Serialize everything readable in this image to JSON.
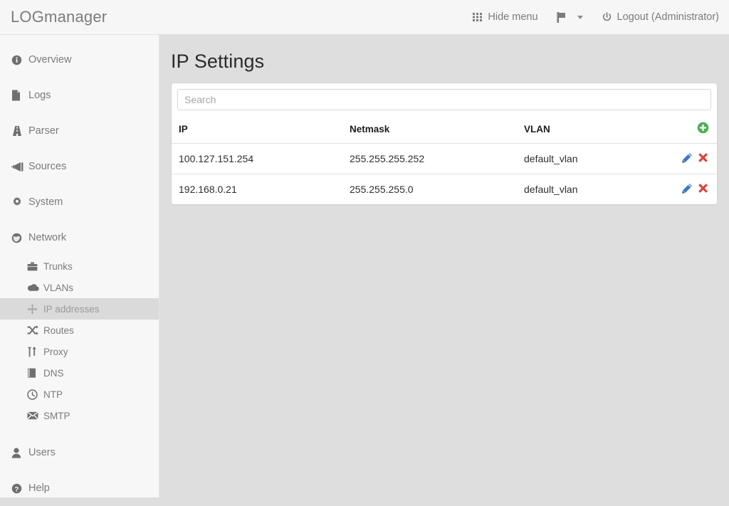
{
  "header": {
    "brand": "LOGmanager",
    "hide_menu_label": "Hide menu",
    "hide_menu_icon": "grid-icon",
    "language_icon": "flag-icon",
    "logout_label": "Logout (Administrator)",
    "logout_icon": "power-icon"
  },
  "sidebar": {
    "items": [
      {
        "label": "Overview",
        "icon": "info-circle-icon",
        "level": "main",
        "active": false
      },
      {
        "label": "Logs",
        "icon": "file-icon",
        "level": "main",
        "active": false
      },
      {
        "label": "Parser",
        "icon": "road-icon",
        "level": "main",
        "active": false
      },
      {
        "label": "Sources",
        "icon": "bullhorn-icon",
        "level": "main",
        "active": false
      },
      {
        "label": "System",
        "icon": "gear-icon",
        "level": "main",
        "active": false
      },
      {
        "label": "Network",
        "icon": "globe-icon",
        "level": "main",
        "active": false
      },
      {
        "label": "Trunks",
        "icon": "briefcase-icon",
        "level": "sub",
        "active": false
      },
      {
        "label": "VLANs",
        "icon": "cloud-icon",
        "level": "sub",
        "active": false
      },
      {
        "label": "IP addresses",
        "icon": "move-arrows-icon",
        "level": "sub",
        "active": true
      },
      {
        "label": "Routes",
        "icon": "shuffle-icon",
        "level": "sub",
        "active": false
      },
      {
        "label": "Proxy",
        "icon": "updown-arrows-icon",
        "level": "sub",
        "active": false
      },
      {
        "label": "DNS",
        "icon": "book-icon",
        "level": "sub",
        "active": false
      },
      {
        "label": "NTP",
        "icon": "clock-icon",
        "level": "sub",
        "active": false
      },
      {
        "label": "SMTP",
        "icon": "envelope-icon",
        "level": "sub",
        "active": false
      },
      {
        "label": "Users",
        "icon": "user-icon",
        "level": "main",
        "active": false
      },
      {
        "label": "Help",
        "icon": "question-circle-icon",
        "level": "main",
        "active": false
      }
    ]
  },
  "main": {
    "title": "IP Settings",
    "search": {
      "value": "",
      "placeholder": "Search"
    },
    "table": {
      "columns": [
        "IP",
        "Netmask",
        "VLAN"
      ],
      "add_icon": "plus-circle-icon",
      "rows": [
        {
          "ip": "100.127.151.254",
          "netmask": "255.255.255.252",
          "vlan": "default_vlan",
          "edit_icon": "pencil-icon",
          "delete_icon": "x-icon"
        },
        {
          "ip": "192.168.0.21",
          "netmask": "255.255.255.0",
          "vlan": "default_vlan",
          "edit_icon": "pencil-icon",
          "delete_icon": "x-icon"
        }
      ]
    }
  },
  "colors": {
    "add_green": "#4caf50",
    "edit_blue": "#3c78c8",
    "delete_red": "#d9453c",
    "active_nav_bg": "#dadada",
    "content_bg": "#dedede",
    "panel_bg": "#ffffff",
    "text_gray": "#7b7b7b"
  }
}
